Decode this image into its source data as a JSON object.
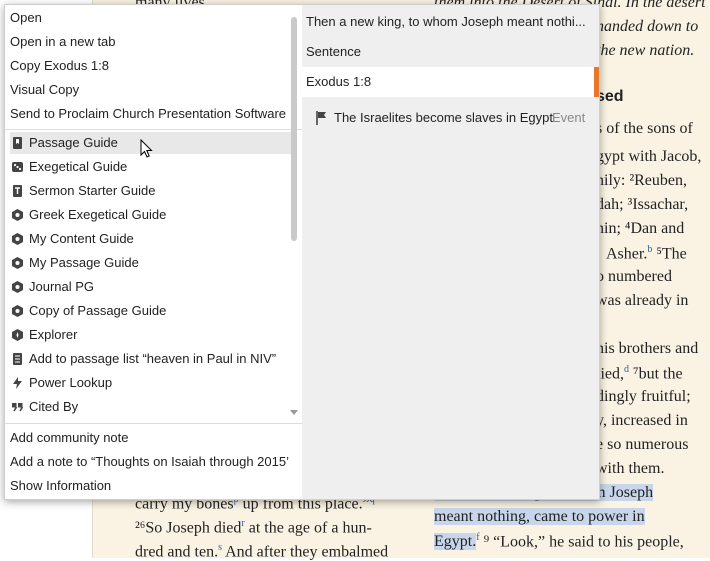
{
  "background": {
    "left_lines": [
      "many lives.",
      "carry my bones",
      "up from this place.”",
      "²⁶So Joseph died",
      "at the age of a hun-",
      "dred and ten.",
      "And after they embalmed"
    ],
    "right_lines": {
      "l1": "them into the Desert of Sinai. In the desert",
      "l2": "handed down to",
      "l3": "the new nation.",
      "heading": "sed",
      "r4": "s of the sons of",
      "r5": "gypt with Jacob,",
      "r6": "nily: ²Reuben,",
      "r7": "dah; ³Issachar,",
      "r8": "nin; ⁴Dan and",
      "r9": "Asher.",
      "r9b": "⁵The",
      "r10": "o numbered",
      "r11": "was already in",
      "r12": "his brothers and",
      "r13": "lied,",
      "r13b": "⁷but the",
      "r14": "dingly fruitful;",
      "r15": "y, increased in",
      "r16": "e so numerous",
      "r17": "with them.",
      "h1": "Then a new king, to whom Joseph",
      "h2": "meant nothing, came to power in",
      "h3": "Egypt.",
      "h3b": "⁹ “",
      "h3c": "Look,” he said to his people,"
    }
  },
  "menu": {
    "top_items": [
      {
        "label": "Open"
      },
      {
        "label": "Open in a new tab"
      },
      {
        "label": "Copy Exodus 1:8"
      },
      {
        "label": "Visual Copy"
      },
      {
        "label": "Send to Proclaim Church Presentation Software"
      }
    ],
    "guide_items": [
      {
        "label": "Passage Guide",
        "icon": "bookmark-icon"
      },
      {
        "label": "Exegetical Guide",
        "icon": "dice-icon"
      },
      {
        "label": "Sermon Starter Guide",
        "icon": "sermon-icon"
      },
      {
        "label": "Greek Exegetical Guide",
        "icon": "guide-hex-icon"
      },
      {
        "label": "My Content Guide",
        "icon": "guide-hex-icon"
      },
      {
        "label": "My Passage Guide",
        "icon": "guide-hex-icon"
      },
      {
        "label": "Journal PG",
        "icon": "guide-hex-icon"
      },
      {
        "label": "Copy of Passage Guide",
        "icon": "guide-hex-icon"
      },
      {
        "label": "Explorer",
        "icon": "explorer-icon"
      },
      {
        "label": "Add to passage list “heaven in Paul in NIV”",
        "icon": "list-icon"
      },
      {
        "label": "Power Lookup",
        "icon": "lightning-icon"
      },
      {
        "label": "Cited By",
        "icon": "quote-icon"
      }
    ],
    "bottom_items": [
      {
        "label": "Add community note"
      },
      {
        "label": "Add a note to “Thoughts on Isaiah through 2015’"
      },
      {
        "label": "Show Information"
      }
    ],
    "right": {
      "selection": "Then a new king, to whom Joseph meant nothi...",
      "sentence": "Sentence",
      "reference": "Exodus 1:8",
      "event_label": "The Israelites become slaves in Egypt",
      "event_tag": "Event"
    }
  },
  "colors": {
    "accent": "#e8772a",
    "highlight": "#c7d6ea",
    "page_bg": "#faf3e3"
  }
}
